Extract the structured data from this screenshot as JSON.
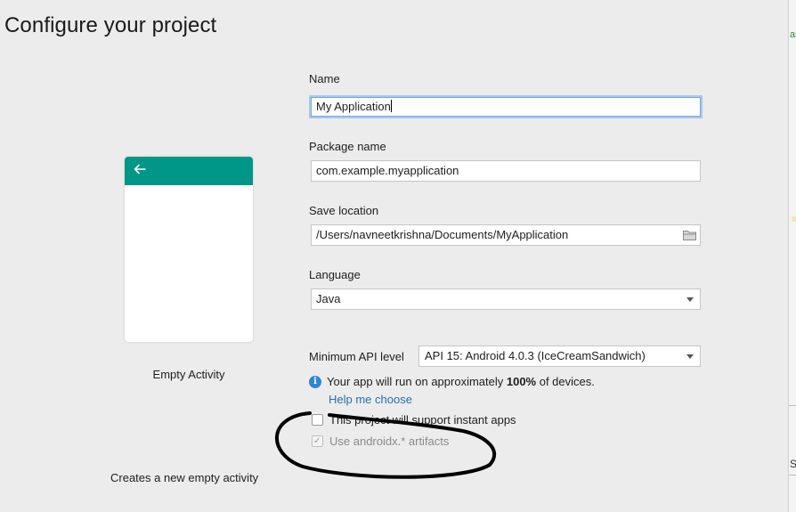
{
  "header": {
    "title": "Configure your project"
  },
  "template": {
    "activity_name": "Empty Activity",
    "description": "Creates a new empty activity",
    "toolbar_color": "#009688"
  },
  "form": {
    "name": {
      "label": "Name",
      "value": "My Application"
    },
    "package": {
      "label": "Package name",
      "value": "com.example.myapplication"
    },
    "save_location": {
      "label": "Save location",
      "value": "/Users/navneetkrishna/Documents/MyApplication",
      "icon": "folder-icon"
    },
    "language": {
      "label": "Language",
      "value": "Java"
    },
    "min_api": {
      "label": "Minimum API level",
      "value": "API 15: Android 4.0.3 (IceCreamSandwich)"
    },
    "info": {
      "prefix": "Your app will run on approximately ",
      "percent": "100%",
      "suffix": " of devices."
    },
    "help_link": "Help me choose",
    "instant_apps": {
      "label": "This project will support instant apps",
      "checked": false
    },
    "androidx": {
      "label": "Use androidx.* artifacts",
      "checked": true,
      "disabled": true
    }
  },
  "side_panel": {
    "fragment_top": "ar",
    "fragment_bottom": "S"
  },
  "colors": {
    "accent": "#009688",
    "link": "#2470b3",
    "info": "#2c87d4"
  }
}
